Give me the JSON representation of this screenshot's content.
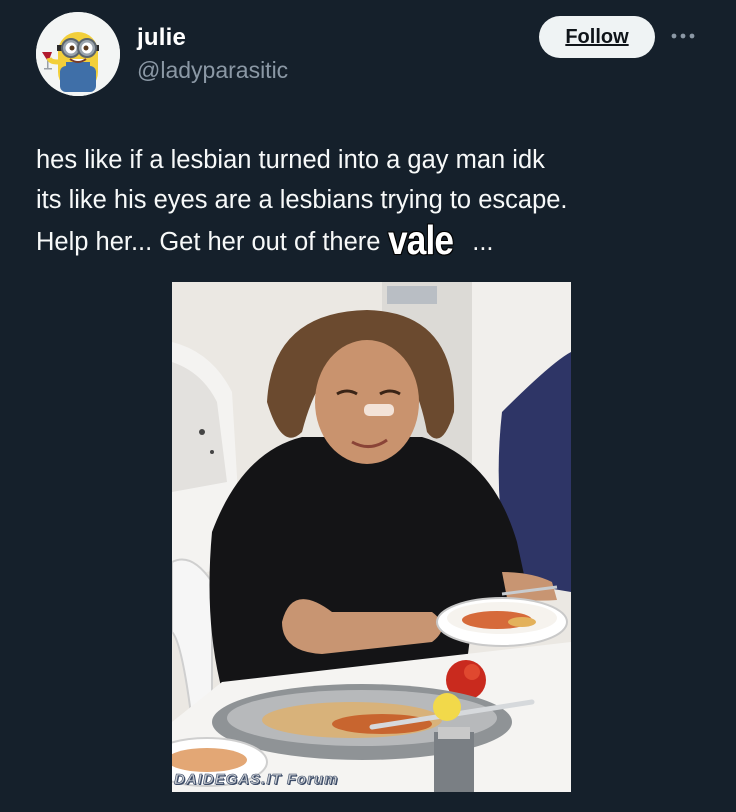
{
  "tweet": {
    "author": {
      "display_name": "julie",
      "handle": "@ladyparasitic",
      "avatar_icon": "minion-avatar"
    },
    "follow_label": "Follow",
    "more_icon": "more-horizontal-icon",
    "text_lines": [
      "hes like if a lesbian turned into a gay man idk",
      "its like his eyes are a lesbians trying to escape.",
      "Help her... Get her out of there"
    ],
    "overlay_label": "vale",
    "trailing_text": "...",
    "media": {
      "watermark": "DAIDEGAS.IT Forum"
    }
  },
  "colors": {
    "background": "#15202b",
    "text": "#f7f9f9",
    "secondary_text": "#8b98a5",
    "follow_button_bg": "#eff3f4"
  }
}
